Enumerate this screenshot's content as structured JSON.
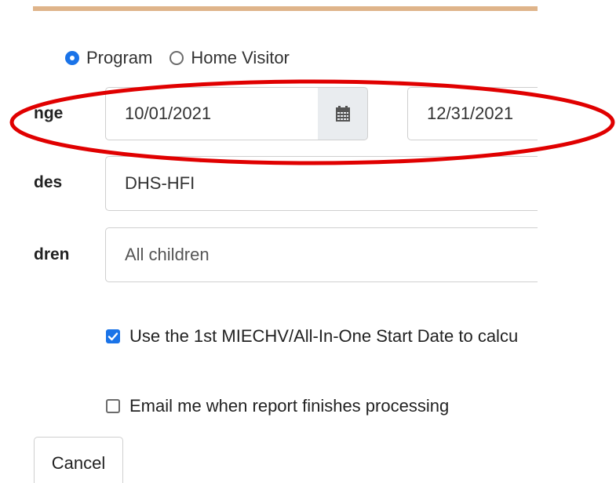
{
  "report_scope": {
    "options": [
      {
        "label": "Program",
        "checked": true
      },
      {
        "label": "Home Visitor",
        "checked": false
      }
    ]
  },
  "date_range": {
    "label": "nge",
    "start": "10/01/2021",
    "end": "12/31/2021",
    "calendar_icon": "calendar-icon"
  },
  "codes": {
    "label": "des",
    "value": "DHS-HFI"
  },
  "children": {
    "label": "dren",
    "value": "All children"
  },
  "options": {
    "miechv": {
      "label": "Use the 1st MIECHV/All-In-One Start Date to calcu",
      "checked": true
    },
    "email": {
      "label": "Email me when report finishes processing",
      "checked": false
    }
  },
  "buttons": {
    "cancel": "Cancel"
  },
  "colors": {
    "accent": "#1a73e8",
    "top_rule": "#dfb48a",
    "annotation": "#e00000"
  }
}
